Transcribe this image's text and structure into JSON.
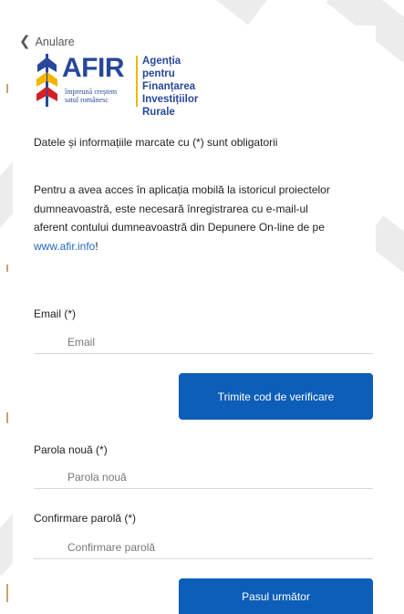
{
  "nav": {
    "back_label": "Anulare"
  },
  "logo": {
    "name": "AFIR",
    "tagline": [
      "împreună creștem",
      "satul românesc"
    ],
    "agency_lines": [
      "Agenția",
      "pentru Finanțarea",
      "Investițiilor",
      "Rurale"
    ]
  },
  "form": {
    "required_note": "Datele și informațiile marcate cu (*) sunt obligatorii",
    "intro_text": "Pentru a avea acces în aplicația mobilă la istoricul proiectelor dumneavoastră, este necesară înregistrarea cu e-mail-ul aferent contului dumneavoastră din Depunere On-line de pe ",
    "intro_link": "www.afir.info",
    "intro_suffix": "!",
    "email": {
      "label": "Email (*)",
      "placeholder": "Email",
      "value": ""
    },
    "send_code_button": "Trimite cod de verificare",
    "new_password": {
      "label": "Parola nouă (*)",
      "placeholder": "Parola nouă",
      "value": ""
    },
    "confirm_password": {
      "label": "Confirmare parolă (*)",
      "placeholder": "Confirmare parolă",
      "value": ""
    },
    "next_button": "Pasul următor"
  },
  "colors": {
    "primary_button": "#0d5eb8",
    "brand_blue": "#27479a",
    "brand_yellow": "#f2b400",
    "link": "#1f68c4"
  }
}
